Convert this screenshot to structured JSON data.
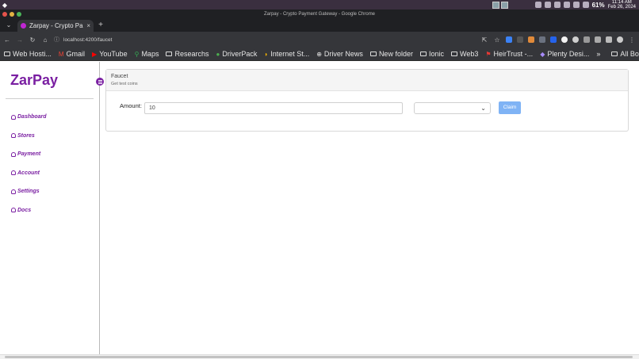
{
  "os": {
    "battery": "61%",
    "time": "11:14 AM",
    "date": "Feb 26, 2024"
  },
  "window": {
    "title": "Zarpay - Crypto Payment Gateway - Google Chrome"
  },
  "tab": {
    "title": "Zarpay - Crypto Pa",
    "close": "×",
    "new_tab": "+"
  },
  "address": {
    "url": "localhost:4200/faucet"
  },
  "bookmarks": [
    {
      "label": "Web Hosti..."
    },
    {
      "label": "Gmail"
    },
    {
      "label": "YouTube"
    },
    {
      "label": "Maps"
    },
    {
      "label": "Researchs"
    },
    {
      "label": "DriverPack"
    },
    {
      "label": "Internet St..."
    },
    {
      "label": "Driver News"
    },
    {
      "label": "New folder"
    },
    {
      "label": "Ionic"
    },
    {
      "label": "Web3"
    },
    {
      "label": "HeirTrust -..."
    },
    {
      "label": "Plenty Desi..."
    }
  ],
  "bookmarks_more": "»",
  "bookmarks_all": "All Bookmarks",
  "sidebar": {
    "brand": "ZarPay",
    "items": [
      {
        "label": "Dashboard"
      },
      {
        "label": "Stores"
      },
      {
        "label": "Payment"
      },
      {
        "label": "Account"
      },
      {
        "label": "Settings"
      },
      {
        "label": "Docs"
      }
    ]
  },
  "faucet": {
    "title": "Faucet",
    "subtitle": "Get test coins",
    "amount_label": "Amount:",
    "amount_value": "10",
    "coin_value": "",
    "claim_label": "Claim"
  },
  "colors": {
    "brand": "#7a1fa2",
    "claim_button": "#7fb3f5",
    "chrome_dark": "#35363a"
  }
}
